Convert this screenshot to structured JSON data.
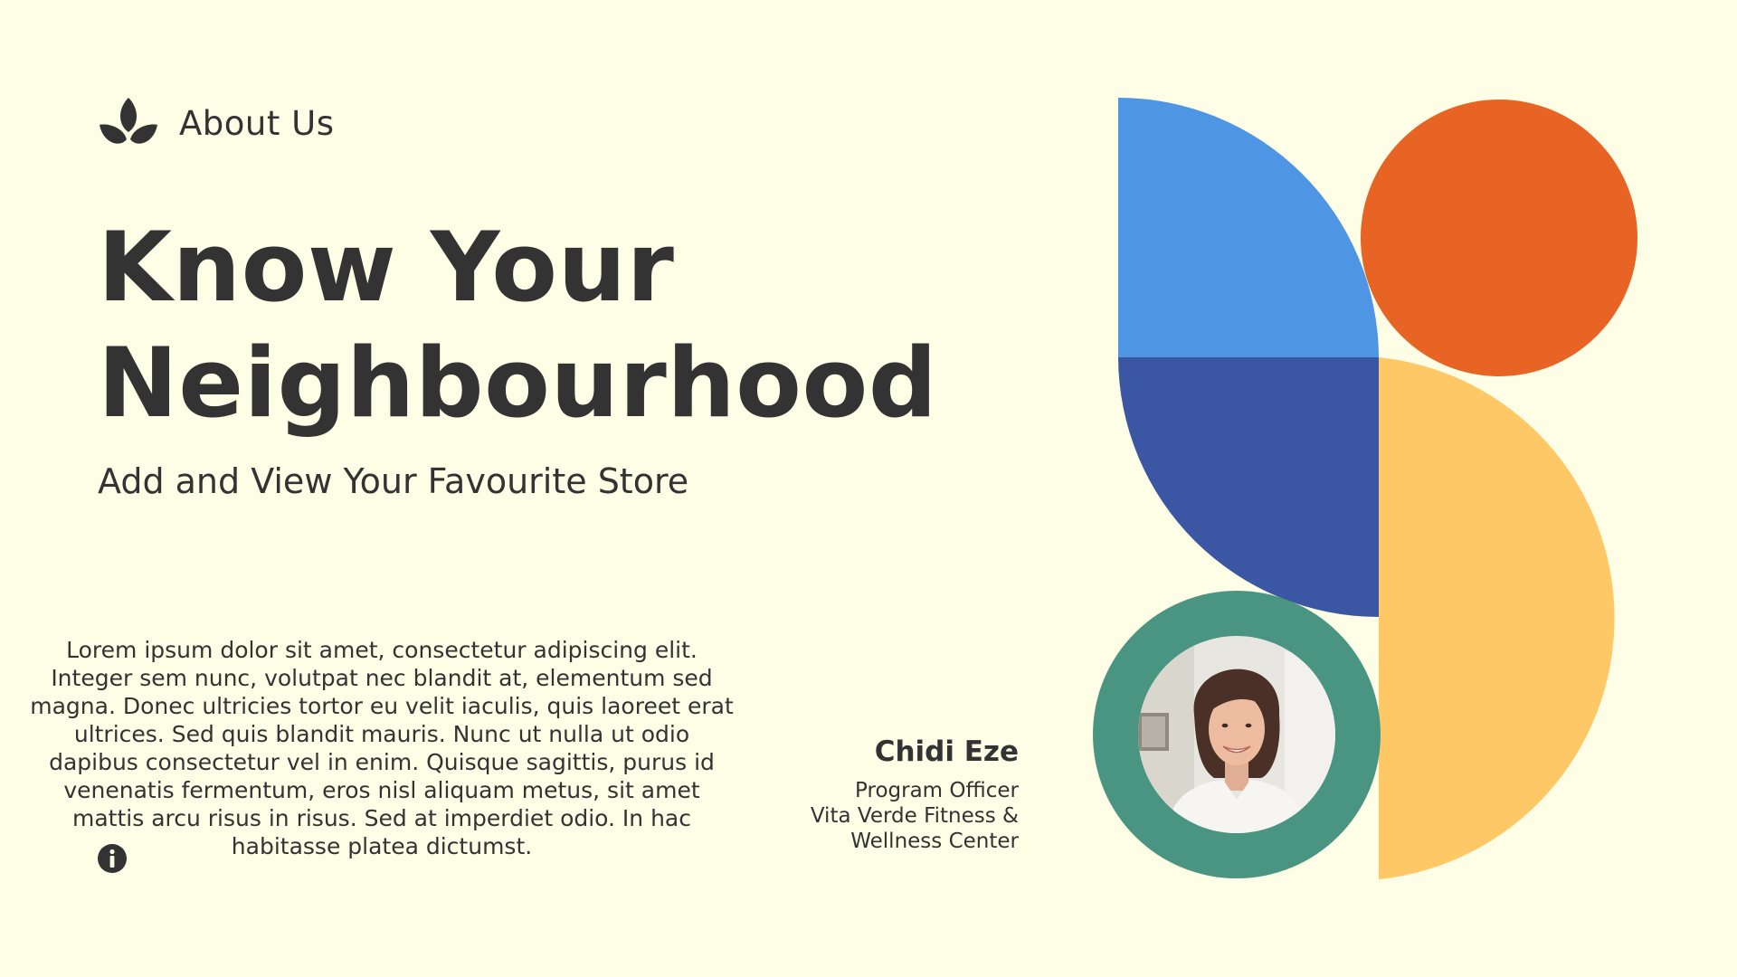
{
  "header": {
    "label": "About Us",
    "icon": "leaf-icon"
  },
  "hero": {
    "title_line1": "Know Your",
    "title_line2": "Neighbourhood",
    "subtitle": "Add and View Your Favourite Store"
  },
  "body": {
    "paragraph": "Lorem ipsum dolor sit amet, consectetur adipiscing elit. Integer sem nunc, volutpat nec blandit at, elementum sed magna. Donec ultricies tortor eu velit iaculis, quis laoreet erat ultrices. Sed quis blandit mauris. Nunc ut nulla ut odio dapibus consectetur vel in enim. Quisque sagittis, purus id venenatis fermentum, eros nisl aliquam metus, sit amet mattis arcu risus in risus. Sed at imperdiet odio. In hac habitasse platea dictumst."
  },
  "person": {
    "name": "Chidi Eze",
    "role_line1": "Program Officer",
    "role_line2": "Vita Verde Fitness &",
    "role_line3": "Wellness Center"
  },
  "icons": {
    "info": "info-icon"
  },
  "colors": {
    "background": "#FEFDE6",
    "text": "#333333",
    "light_blue": "#4E95E3",
    "dark_blue": "#3B56A2",
    "orange": "#E76424",
    "yellow": "#FEC866",
    "teal": "#4A9482"
  }
}
